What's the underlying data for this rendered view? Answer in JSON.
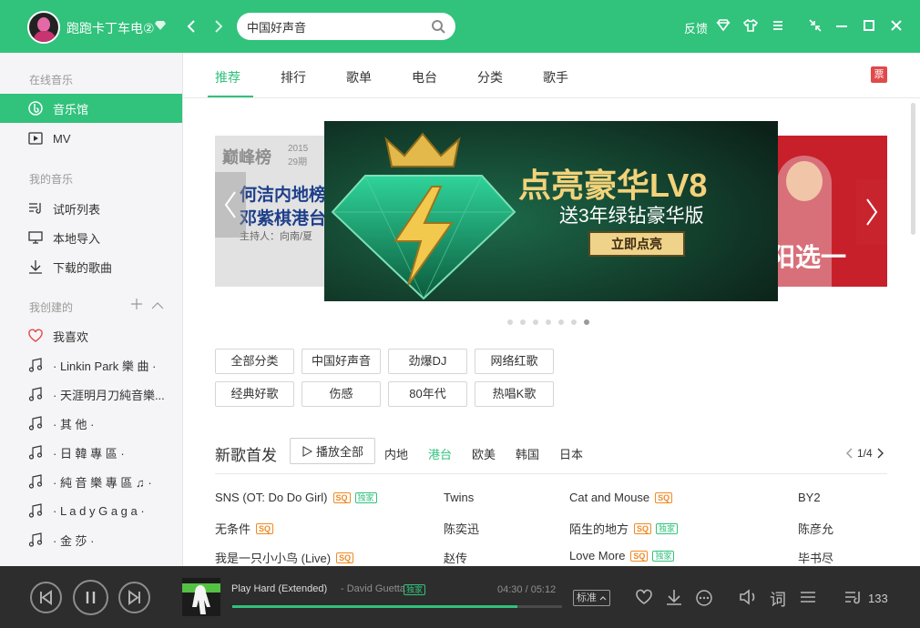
{
  "titlebar": {
    "username": "跑跑卡丁车电②",
    "search_value": "中国好声音",
    "feedback_label": "反馈",
    "icons": [
      "back-icon",
      "forward-icon",
      "search-icon",
      "diamond-icon",
      "skin-icon",
      "menu-icon",
      "mini-mode-icon",
      "minimize-icon",
      "maximize-icon",
      "close-icon"
    ]
  },
  "sidebar": {
    "online_music": "在线音乐",
    "music_hall": "音乐馆",
    "mv": "MV",
    "my_music": "我的音乐",
    "trial_list": "试听列表",
    "local_import": "本地导入",
    "downloaded": "下载的歌曲",
    "my_created": "我创建的",
    "playlists": [
      {
        "label": "我喜欢"
      },
      {
        "label": "· Linkin Park 樂 曲 ·"
      },
      {
        "label": "· 天涯明月刀純音樂..."
      },
      {
        "label": "· 其 他 ·"
      },
      {
        "label": "· 日 韓 專 區 ·"
      },
      {
        "label": "· 純 音 樂 專 區 ♫ ·"
      },
      {
        "label": "· L a d y G a g a ·"
      },
      {
        "label": "· 金 莎 ·"
      }
    ]
  },
  "tabs": [
    "推荐",
    "排行",
    "歌单",
    "电台",
    "分类",
    "歌手"
  ],
  "ticket_label": "票",
  "banner": {
    "left_logo": "巅峰榜",
    "left_year": "2015",
    "left_issue": "29期",
    "left_line1": "何洁内地榜",
    "left_line2": "邓紫棋港台",
    "left_host": "主持人：向南/夏",
    "main_title": "点亮豪华LV8",
    "main_sub": "送3年绿钻豪华版",
    "main_cta": "立即点亮",
    "right_text": "阳选一",
    "dots": 7,
    "active_dot": 6
  },
  "tags": [
    "全部分类",
    "中国好声音",
    "劲爆DJ",
    "网络红歌",
    "经典好歌",
    "伤感",
    "80年代",
    "热唱K歌"
  ],
  "new_songs": {
    "title": "新歌首发",
    "play_all": "播放全部",
    "regions": [
      "内地",
      "港台",
      "欧美",
      "韩国",
      "日本"
    ],
    "active_region": 1,
    "page": "1/4",
    "songs": [
      {
        "title": "SNS (OT: Do Do Girl)",
        "sq": "SQ",
        "exclusive": "独家",
        "artist": "Twins"
      },
      {
        "title": "Cat and Mouse",
        "sq": "SQ",
        "exclusive": "",
        "artist": "BY2"
      },
      {
        "title": "无条件",
        "sq": "SQ",
        "exclusive": "",
        "artist": "陈奕迅"
      },
      {
        "title": "陌生的地方",
        "sq": "SQ",
        "exclusive": "独家",
        "artist": "陈彦允"
      },
      {
        "title": "我是一只小小鸟 (Live)",
        "sq": "SQ",
        "exclusive": "",
        "artist": "赵传"
      },
      {
        "title": "Love More",
        "sq": "SQ",
        "exclusive": "独家",
        "artist": "毕书尽"
      }
    ]
  },
  "player": {
    "song": "Play Hard (Extended)",
    "artist": "- David Guetta",
    "exclusive": "独家",
    "time": "04:30 / 05:12",
    "progress": 0.865,
    "quality": "标准",
    "lyrics_label": "词",
    "playlist_count": "133",
    "accent": "#31c27c"
  }
}
